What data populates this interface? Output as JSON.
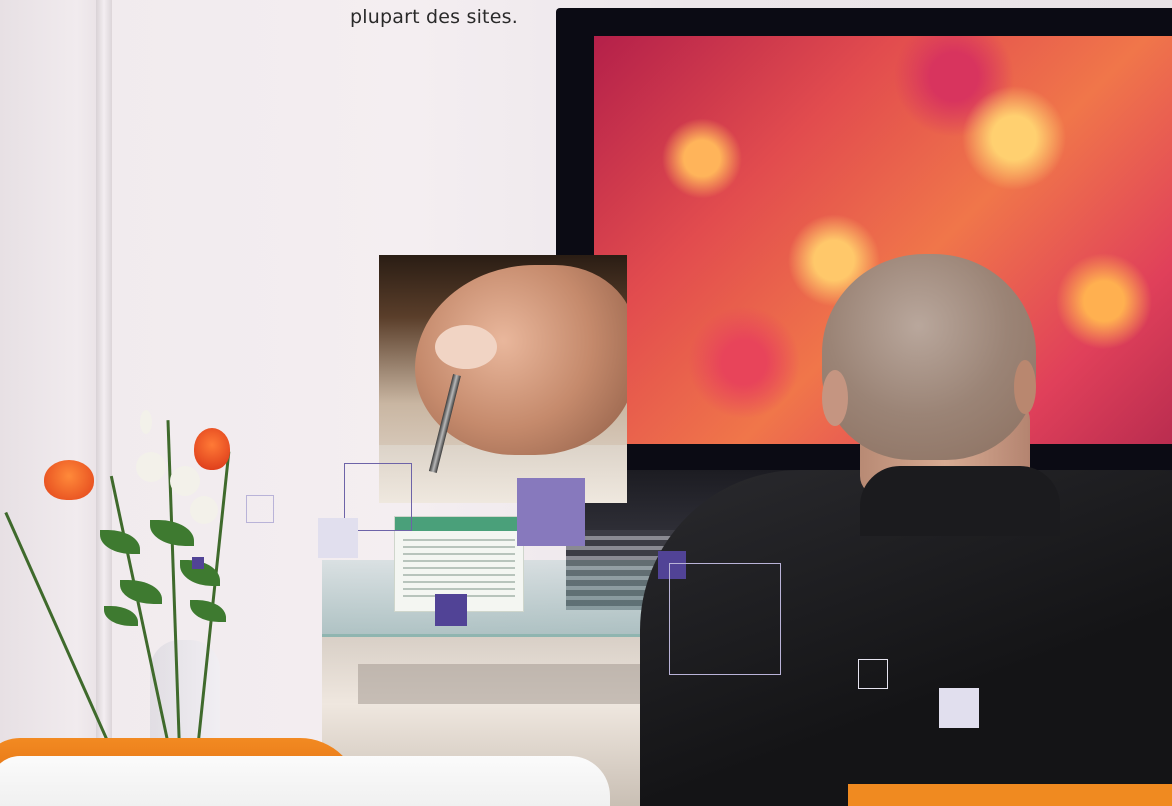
{
  "caption": {
    "text": "plupart des sites."
  },
  "scene": {
    "description_labels": {
      "tv": "flat-screen-tv",
      "photo": "writing-hand-photo",
      "person": "man-watching-tv"
    }
  },
  "colors": {
    "accent_dark": "#514396",
    "accent_mid": "#8779bd",
    "accent_pale": "#e1dfee",
    "sofa_orange": "#f08a20"
  }
}
